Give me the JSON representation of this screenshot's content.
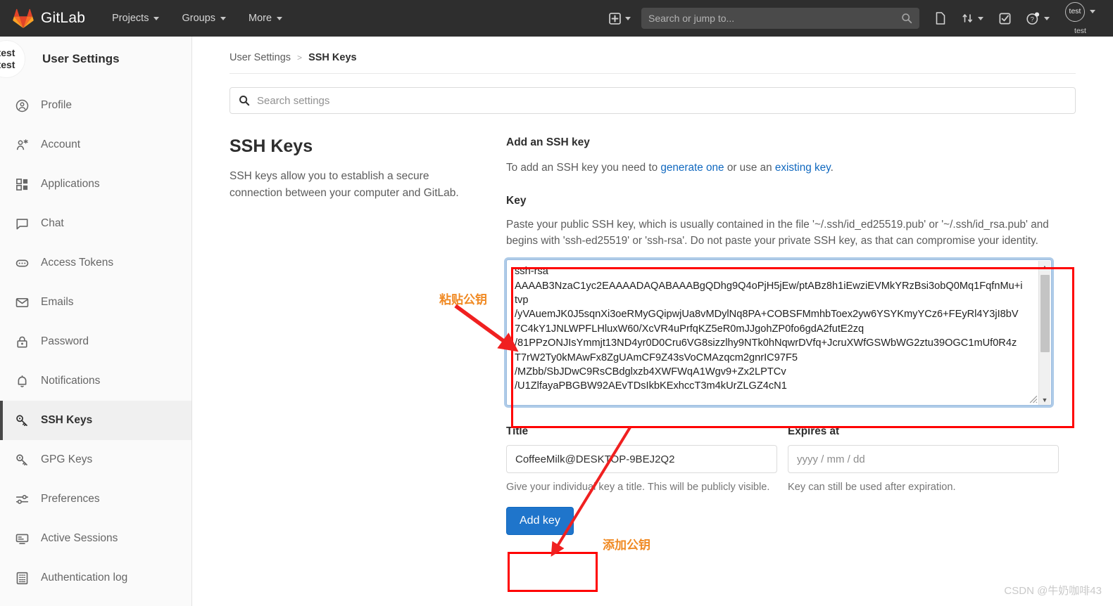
{
  "navbar": {
    "brand": "GitLab",
    "menu": [
      {
        "label": "Projects",
        "icon": "chevron-down-icon"
      },
      {
        "label": "Groups",
        "icon": "chevron-down-icon"
      },
      {
        "label": "More",
        "icon": "chevron-down-icon"
      }
    ],
    "plus_icon": "plus-square-icon",
    "search_placeholder": "Search or jump to...",
    "search_icon": "search-icon",
    "icons": [
      {
        "name": "issues-icon"
      },
      {
        "name": "merge-requests-icon"
      },
      {
        "name": "todos-icon"
      },
      {
        "name": "help-icon"
      }
    ],
    "user": {
      "avatar_initials": "test",
      "name": "test"
    }
  },
  "sidebar": {
    "avatar_line1": "test",
    "avatar_line2": "test",
    "title": "User Settings",
    "items": [
      {
        "label": "Profile",
        "icon": "profile-icon",
        "active": false
      },
      {
        "label": "Account",
        "icon": "account-icon",
        "active": false
      },
      {
        "label": "Applications",
        "icon": "applications-icon",
        "active": false
      },
      {
        "label": "Chat",
        "icon": "chat-icon",
        "active": false
      },
      {
        "label": "Access Tokens",
        "icon": "access-tokens-icon",
        "active": false
      },
      {
        "label": "Emails",
        "icon": "email-icon",
        "active": false
      },
      {
        "label": "Password",
        "icon": "lock-icon",
        "active": false
      },
      {
        "label": "Notifications",
        "icon": "bell-icon",
        "active": false
      },
      {
        "label": "SSH Keys",
        "icon": "key-icon",
        "active": true
      },
      {
        "label": "GPG Keys",
        "icon": "key-icon",
        "active": false
      },
      {
        "label": "Preferences",
        "icon": "sliders-icon",
        "active": false
      },
      {
        "label": "Active Sessions",
        "icon": "monitor-icon",
        "active": false
      },
      {
        "label": "Authentication log",
        "icon": "log-icon",
        "active": false
      }
    ]
  },
  "breadcrumb": {
    "parent": "User Settings",
    "separator": ">",
    "current": "SSH Keys"
  },
  "settings_search": {
    "placeholder": "Search settings",
    "icon": "search-icon"
  },
  "left_panel": {
    "heading": "SSH Keys",
    "description": "SSH keys allow you to establish a secure connection between your computer and GitLab."
  },
  "add_key": {
    "heading": "Add an SSH key",
    "intro_before": "To add an SSH key you need to ",
    "link_generate": "generate one",
    "intro_middle": " or use an ",
    "link_existing": "existing key",
    "intro_after": ".",
    "key_label": "Key",
    "key_help": "Paste your public SSH key, which is usually contained in the file '~/.ssh/id_ed25519.pub' or '~/.ssh/id_rsa.pub' and begins with 'ssh-ed25519' or 'ssh-rsa'. Do not paste your private SSH key, as that can compromise your identity.",
    "key_value": "ssh-rsa\nAAAAB3NzaC1yc2EAAAADAQABAAABgQDhg9Q4oPjH5jEw/ptABz8h1iEwziEVMkYRzBsi3obQ0Mq1FqfnMu+itvp\n/yVAuemJK0J5sqnXi3oeRMyGQipwjUa8vMDylNq8PA+COBSFMmhbToex2yw6YSYKmyYCz6+FEyRl4Y3jI8bV7C4kY1JNLWPFLHluxW60/XcVR4uPrfqKZ5eR0mJJgohZP0fo6gdA2futE2zq\n/81PPzONJIsYmmjt13ND4yr0D0Cru6VG8sizzlhy9NTk0hNqwrDVfq+JcruXWfGSWbWG2ztu39OGC1mUf0R4zT7rW2Ty0kMAwFx8ZgUAmCF9Z43sVoCMAzqcm2gnrIC97F5\n/MZbb/SbJDwC9RsCBdglxzb4XWFWqA1Wgv9+Zx2LPTCv\n/U1ZlfayaPBGBW92AEvTDsIkbKExhccT3m4kUrZLGZ4cN1",
    "title_label": "Title",
    "title_value": "CoffeeMilk@DESKTOP-9BEJ2Q2",
    "title_hint": "Give your individual key a title. This will be publicly visible.",
    "expires_label": "Expires at",
    "expires_placeholder": "yyyy / mm / dd",
    "expires_hint": "Key can still be used after expiration.",
    "submit_label": "Add key",
    "scroll_up_icon": "chevron-up-icon",
    "scroll_down_icon": "chevron-down-icon"
  },
  "annotations": {
    "paste_key": "粘贴公钥",
    "add_key": "添加公钥",
    "color": "#f08a24",
    "box_color": "#ff0000"
  },
  "watermark": "CSDN @牛奶咖啡43"
}
